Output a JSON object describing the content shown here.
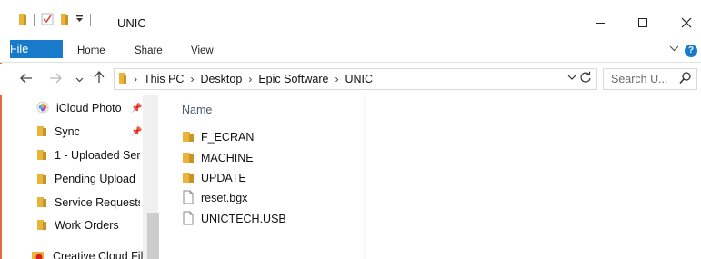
{
  "window": {
    "title": "UNIC",
    "controls": [
      "minimize",
      "maximize",
      "close"
    ]
  },
  "ribbon": {
    "tabs": [
      {
        "label": "File",
        "active": true
      },
      {
        "label": "Home"
      },
      {
        "label": "Share"
      },
      {
        "label": "View"
      }
    ],
    "help_label": "?"
  },
  "address_bar": {
    "crumbs": [
      "This PC",
      "Desktop",
      "Epic Software",
      "UNIC"
    ],
    "search_placeholder": "Search U..."
  },
  "nav_pane": {
    "items": [
      {
        "label": "iCloud Photo",
        "icon": "icloud-photos-icon",
        "pinned": true
      },
      {
        "label": "Sync",
        "icon": "folder-icon",
        "pinned": true
      },
      {
        "label": "1 - Uploaded Ser",
        "icon": "folder-icon"
      },
      {
        "label": "Pending Upload",
        "icon": "folder-icon"
      },
      {
        "label": "Service Requests",
        "icon": "folder-icon"
      },
      {
        "label": "Work Orders",
        "icon": "folder-icon"
      },
      {
        "label": "Creative Cloud Fil",
        "icon": "creative-cloud-folder-icon"
      }
    ]
  },
  "content": {
    "column_header": "Name",
    "files": [
      {
        "name": "F_ECRAN",
        "type": "folder"
      },
      {
        "name": "MACHINE",
        "type": "folder"
      },
      {
        "name": "UPDATE",
        "type": "folder"
      },
      {
        "name": "reset.bgx",
        "type": "file"
      },
      {
        "name": "UNICTECH.USB",
        "type": "file"
      }
    ]
  },
  "colors": {
    "accent": "#1979ca",
    "folder": "#e8b43a"
  }
}
